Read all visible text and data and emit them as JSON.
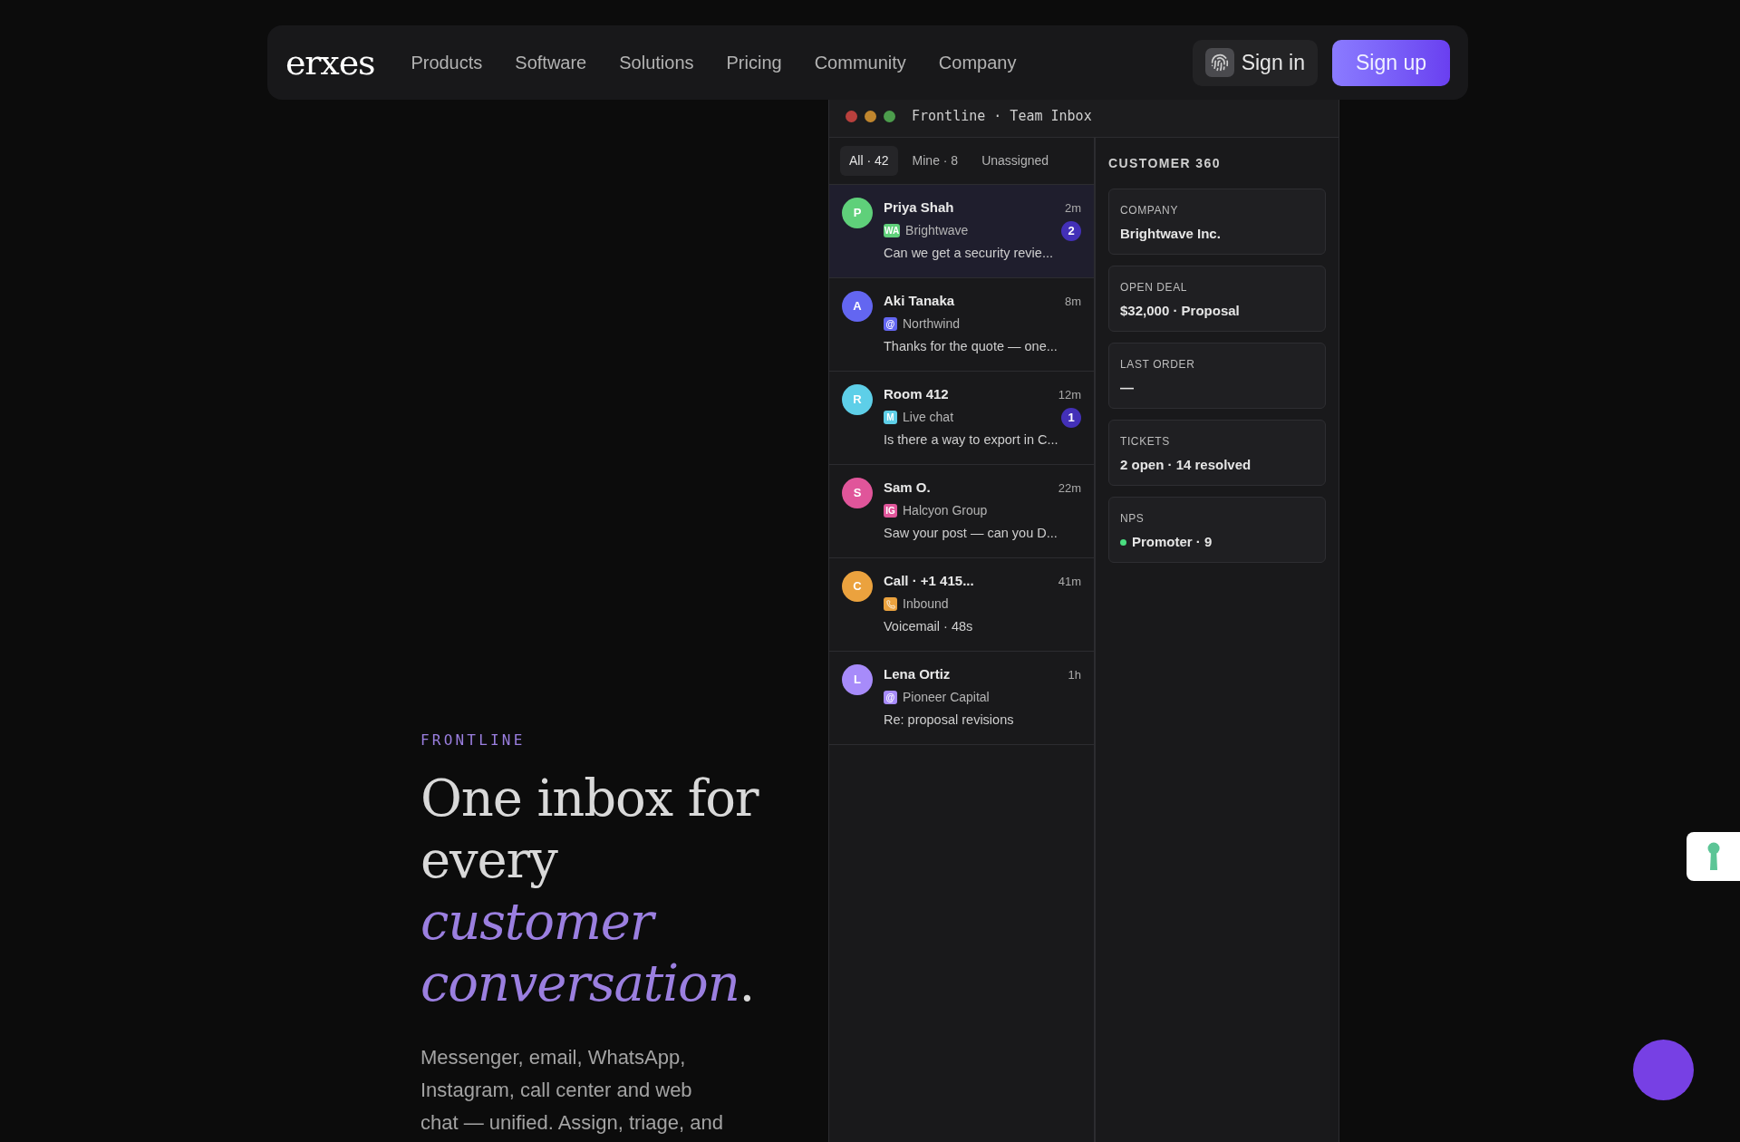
{
  "nav": {
    "logo": "erxes",
    "links": [
      "Products",
      "Software",
      "Solutions",
      "Pricing",
      "Community",
      "Company"
    ],
    "sign_in": "Sign in",
    "sign_up": "Sign up"
  },
  "hero": {
    "eyebrow": "FRONTLINE",
    "heading": "One inbox for every *customer conversation*.",
    "body": "Messenger, email, WhatsApp, Instagram, call center and web chat — unified. Assign, triage, and"
  },
  "inbox": {
    "title": "Frontline · Team Inbox",
    "filters": [
      {
        "label": "All · 42",
        "selected": true
      },
      {
        "label": "Mine · 8",
        "selected": false
      },
      {
        "label": "Unassigned",
        "selected": false
      }
    ],
    "conversations": [
      {
        "initial": "P",
        "name": "Priya Shah",
        "time": "2m",
        "channel": {
          "kind": "text",
          "label": "WA"
        },
        "source": "Brightwave",
        "preview": "Can we get a security revie...",
        "unread": "2",
        "selected": true,
        "color": "#5fd07a"
      },
      {
        "initial": "A",
        "name": "Aki Tanaka",
        "time": "8m",
        "channel": {
          "kind": "text",
          "label": "@"
        },
        "source": "Northwind",
        "preview": "Thanks for the quote — one...",
        "selected": false,
        "color": "#6366f1"
      },
      {
        "initial": "R",
        "name": "Room 412",
        "time": "12m",
        "channel": {
          "kind": "text",
          "label": "M"
        },
        "source": "Live chat",
        "preview": "Is there a way to export in C...",
        "unread": "1",
        "selected": false,
        "color": "#5ecfe8"
      },
      {
        "initial": "S",
        "name": "Sam O.",
        "time": "22m",
        "channel": {
          "kind": "text",
          "label": "IG"
        },
        "source": "Halcyon Group",
        "preview": "Saw your post — can you D...",
        "selected": false,
        "color": "#e0559a"
      },
      {
        "initial": "C",
        "name": "Call · +1 415...",
        "time": "41m",
        "channel": {
          "kind": "phone"
        },
        "source": "Inbound",
        "preview": "Voicemail · 48s",
        "selected": false,
        "color": "#eba23e"
      },
      {
        "initial": "L",
        "name": "Lena Ortiz",
        "time": "1h",
        "channel": {
          "kind": "text",
          "label": "@"
        },
        "source": "Pioneer Capital",
        "preview": "Re: proposal revisions",
        "selected": false,
        "color": "#a78bfa"
      }
    ],
    "customer_panel": {
      "title": "CUSTOMER 360",
      "cards": [
        {
          "label": "COMPANY",
          "value": "Brightwave Inc."
        },
        {
          "label": "OPEN DEAL",
          "value": "$32,000 · Proposal"
        },
        {
          "label": "LAST ORDER",
          "value": "—"
        },
        {
          "label": "TICKETS",
          "value": "2 open · 14 resolved"
        },
        {
          "label": "NPS",
          "value": "Promoter · 9",
          "color": "#4ade80"
        }
      ]
    }
  }
}
